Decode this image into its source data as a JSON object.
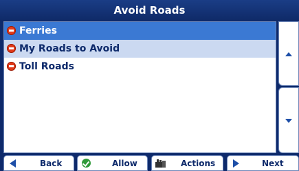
{
  "header": {
    "title": "Avoid Roads"
  },
  "list": {
    "items": [
      {
        "label": "Ferries",
        "state": "selected"
      },
      {
        "label": "My Roads to Avoid",
        "state": "highlighted"
      },
      {
        "label": "Toll Roads",
        "state": "normal"
      }
    ]
  },
  "scroll": {
    "up_icon": "arrow-up",
    "down_icon": "arrow-down"
  },
  "toolbar": {
    "back_label": "Back",
    "allow_label": "Allow",
    "actions_label": "Actions",
    "next_label": "Next"
  },
  "colors": {
    "background": "#0e2a6b",
    "selected_row": "#3b79d3",
    "highlight_row": "#cbd9f1",
    "avoid_icon": "#e23a1a",
    "allow_icon": "#2f9a39",
    "arrow": "#1e4fa8"
  }
}
